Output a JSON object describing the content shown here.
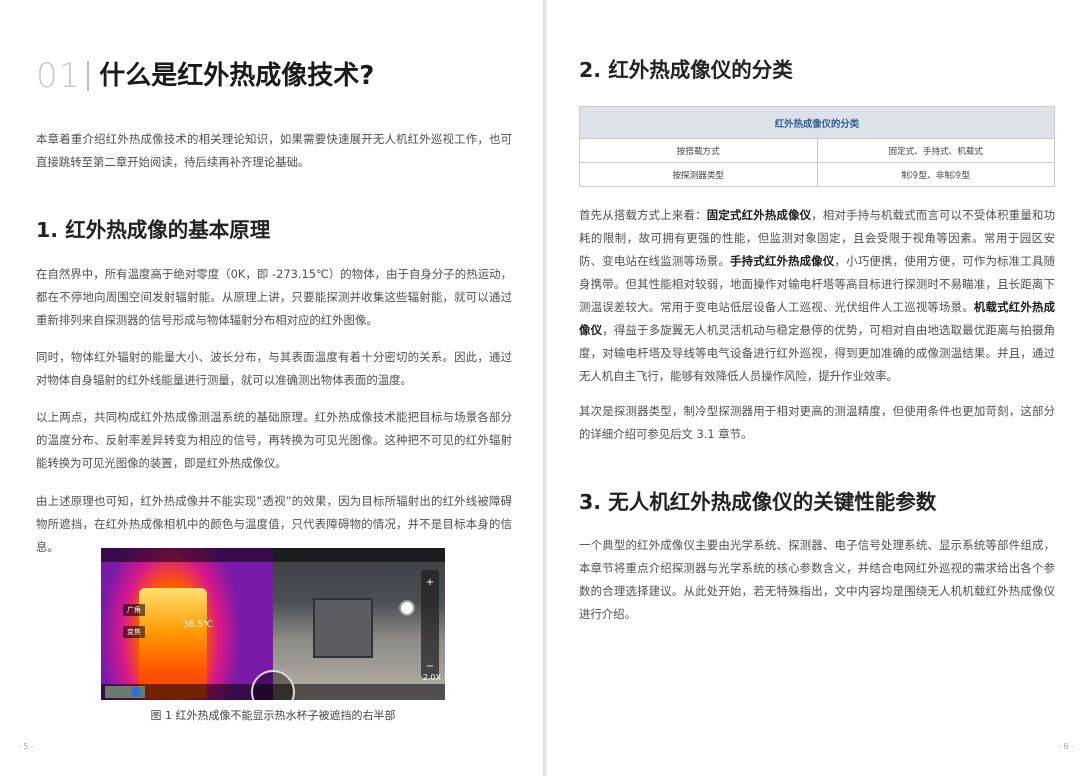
{
  "left_page": {
    "chapter_number": "01",
    "chapter_title": "什么是红外热成像技术?",
    "intro": "本章着重介绍红外热成像技术的相关理论知识，如果需要快速展开无人机红外巡视工作，也可直接跳转至第二章开始阅读，待后续再补齐理论基础。",
    "section1_title": "1. 红外热成像的基本原理",
    "p1": "在自然界中，所有温度高于绝对零度（0K，即 -273.15℃）的物体，由于自身分子的热运动，都在不停地向周围空间发射辐射能。从原理上讲，只要能探测并收集这些辐射能，就可以通过重新排列来自探测器的信号形成与物体辐射分布相对应的红外图像。",
    "p2": "同时，物体红外辐射的能量大小、波长分布，与其表面温度有着十分密切的关系。因此，通过对物体自身辐射的红外线能量进行测量，就可以准确测出物体表面的温度。",
    "p3": "以上两点，共同构成红外热成像测温系统的基础原理。红外热成像技术能把目标与场景各部分的温度分布、反射率差异转变为相应的信号，再转换为可见光图像。这种把不可见的红外辐射能转换为可见光图像的装置，即是红外热成像仪。",
    "p4": "由上述原理也可知，红外热成像并不能实现“透视”的效果，因为目标所辐射出的红外线被障碍物所遮挡，在红外热成像相机中的颜色与温度值，只代表障碍物的情况，并不是目标本身的信息。",
    "figure_caption": "图 1  红外热成像不能显示热水杯子被遮挡的右半部",
    "figure_hud": {
      "label_1": "广角",
      "label_2": "变焦",
      "spot_temp": "36.5℃",
      "zoom": "2.0X",
      "plus": "+",
      "minus": "−"
    },
    "page_number": "- 5 -"
  },
  "right_page": {
    "section2_title": "2. 红外热成像仪的分类",
    "table": {
      "header": "红外热成像仪的分类",
      "rows": [
        [
          "按搭载方式",
          "固定式、手持式、机载式"
        ],
        [
          "按探测器类型",
          "制冷型、非制冷型"
        ]
      ]
    },
    "p1": {
      "s1": "首先从搭载方式上来看：",
      "b1": "固定式红外热成像仪",
      "s2": "，相对手持与机载式而言可以不受体积重量和功耗的限制，故可拥有更强的性能，但监测对象固定，且会受限于视角等因素。常用于园区安防、变电站在线监测等场景。",
      "b2": "手持式红外热成像仪",
      "s3": "，小巧便携，使用方便，可作为标准工具随身携带。但其性能相对较弱，地面操作对输电杆塔等高目标进行探测时不易瞄准，且长距离下测温误差较大。常用于变电站低层设备人工巡视、光伏组件人工巡视等场景。",
      "b3": "机载式红外热成像仪",
      "s4": "，得益于多旋翼无人机灵活机动与稳定悬停的优势，可相对自由地选取最优距离与拍摄角度，对输电杆塔及导线等电气设备进行红外巡视，得到更加准确的成像测温结果。并且，通过无人机自主飞行，能够有效降低人员操作风险，提升作业效率。"
    },
    "p2": "其次是探测器类型，制冷型探测器用于相对更高的测温精度，但使用条件也更加苛刻，这部分的详细介绍可参见后文 3.1 章节。",
    "section3_title": "3. 无人机红外热成像仪的关键性能参数",
    "p3": "一个典型的红外成像仪主要由光学系统、探测器、电子信号处理系统、显示系统等部件组成，本章节将重点介绍探测器与光学系统的核心参数含义，并结合电网红外巡视的需求给出各个参数的合理选择建议。从此处开始，若无特殊指出，文中内容均是围绕无人机机载红外热成像仪进行介绍。",
    "page_number": "- 6 -"
  }
}
